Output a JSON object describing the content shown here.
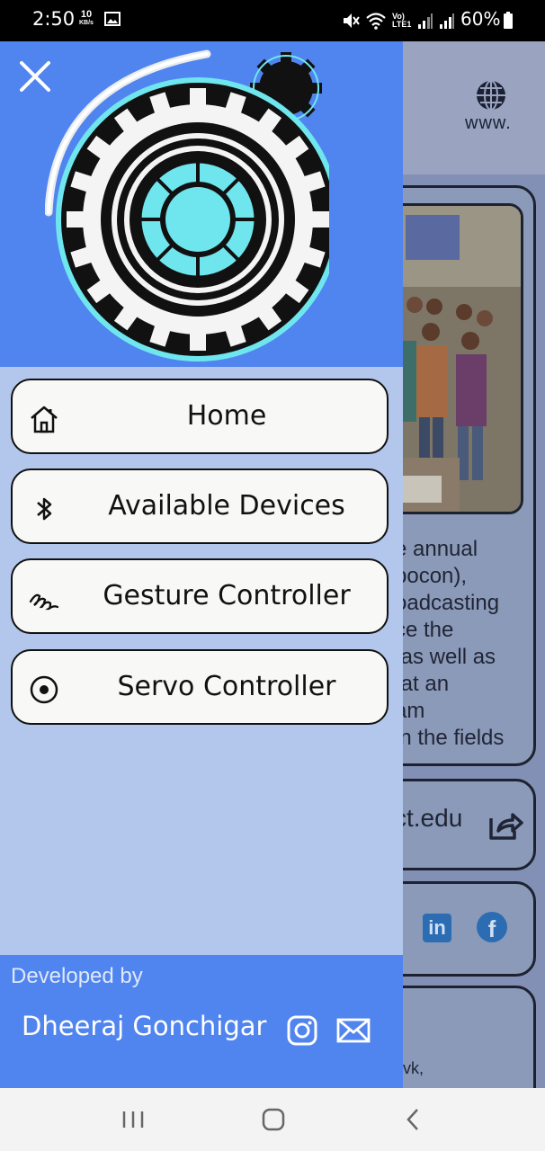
{
  "status_bar": {
    "time": "2:50",
    "net_speed_value": "10",
    "net_speed_unit": "KB/s",
    "network_label": "Vo) LTE1",
    "battery": "60%"
  },
  "drawer": {
    "menu": [
      {
        "label": "Home",
        "icon": "home-icon"
      },
      {
        "label": "Available Devices",
        "icon": "bluetooth-icon"
      },
      {
        "label": "Gesture Controller",
        "icon": "gesture-icon"
      },
      {
        "label": "Servo Controller",
        "icon": "radio-target-icon"
      }
    ],
    "footer": {
      "developed_by": "Developed by",
      "developer_name": "Dheeraj Gonchigar"
    }
  },
  "background_app": {
    "header_text": "www.",
    "partial_text": "e annual\nbocon),\noadcasting\nce the\n as well as\n at an\nam\nin the fields",
    "link_text": "ct.edu",
    "social_in": "in",
    "social_fb": "f",
    "lower_text": "vk,"
  },
  "colors": {
    "drawer_header": "#5084ef",
    "drawer_body": "#b3c6ec",
    "logo_cyan": "#6fe6ee"
  }
}
